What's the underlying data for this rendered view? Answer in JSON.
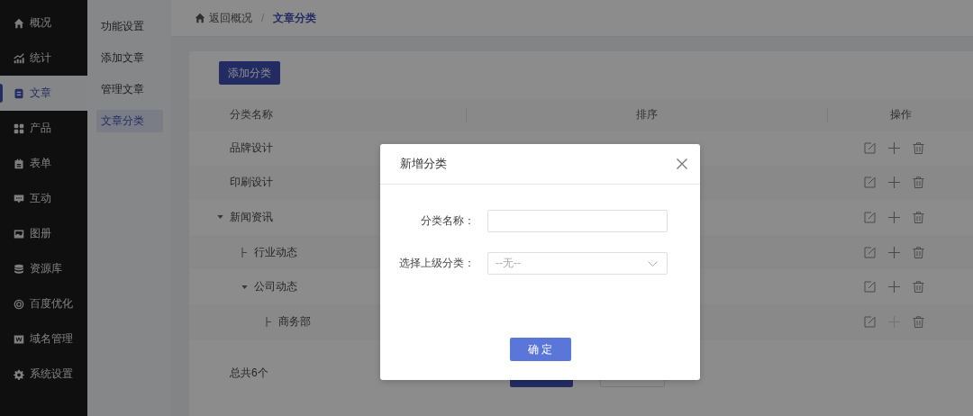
{
  "sidebar": {
    "items": [
      {
        "label": "概况",
        "selected": false
      },
      {
        "label": "统计",
        "selected": false
      },
      {
        "label": "文章",
        "selected": true
      },
      {
        "label": "产品",
        "selected": false
      },
      {
        "label": "表单",
        "selected": false
      },
      {
        "label": "互动",
        "selected": false
      },
      {
        "label": "图册",
        "selected": false
      },
      {
        "label": "资源库",
        "selected": false
      },
      {
        "label": "百度优化",
        "selected": false
      },
      {
        "label": "域名管理",
        "selected": false
      },
      {
        "label": "系统设置",
        "selected": false
      }
    ]
  },
  "submenu": {
    "items": [
      {
        "label": "功能设置",
        "selected": false
      },
      {
        "label": "添加文章",
        "selected": false
      },
      {
        "label": "管理文章",
        "selected": false
      },
      {
        "label": "文章分类",
        "selected": true
      }
    ]
  },
  "breadcrumb": {
    "back": "返回概况",
    "separator": "/",
    "current": "文章分类"
  },
  "add_button": "添加分类",
  "table": {
    "columns": [
      "分类名称",
      "排序",
      "操作"
    ],
    "rows": [
      {
        "name": "品牌设计",
        "can_add": true
      },
      {
        "name": "印刷设计",
        "can_add": true
      },
      {
        "name": "新闻资讯",
        "can_add": true,
        "expanded": true,
        "children": [
          {
            "name": "行业动态",
            "can_add": true
          },
          {
            "name": "公司动态",
            "can_add": true,
            "expanded": true,
            "children": [
              {
                "name": "商务部",
                "can_add": false
              }
            ]
          }
        ]
      }
    ]
  },
  "footer": {
    "total": "总共6个"
  },
  "dialog": {
    "title": "新增分类",
    "fields": [
      {
        "kind": "text",
        "label": "分类名称："
      },
      {
        "kind": "select",
        "label": "选择上级分类：",
        "value": "--无--"
      }
    ],
    "confirm": "确 定"
  }
}
